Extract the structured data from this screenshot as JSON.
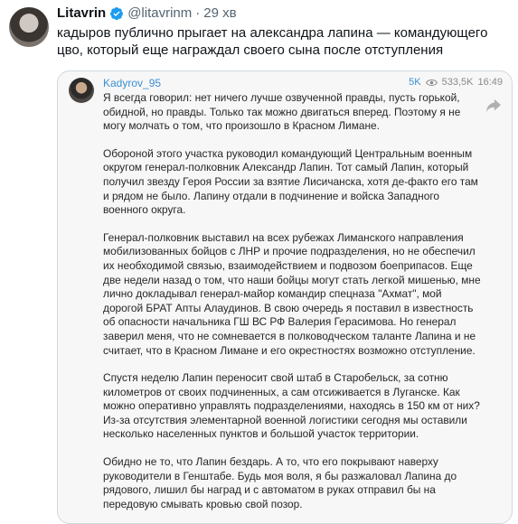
{
  "tweet": {
    "author_name": "Litavrin",
    "handle": "@litavrinm",
    "separator": "·",
    "time": "29 хв",
    "text": "кадыров публично прыгает на александра лапина — командующего цво, который еще награждал своего сына после отступления"
  },
  "embed": {
    "channel": "Kadyrov_95",
    "likes": "5K",
    "views": "533,5K",
    "time": "16:49",
    "paragraphs": [
      "Я всегда говорил: нет ничего лучше озвученной правды, пусть горькой, обидной, но правды. Только так можно двигаться вперед. Поэтому я не могу молчать о том, что произошло в Красном Лимане.",
      "Обороной этого участка руководил командующий Центральным военным округом генерал-полковник Александр Лапин. Тот самый Лапин, который получил звезду Героя России за взятие Лисичанска, хотя де-факто его там и рядом не было. Лапину отдали в подчинение и войска Западного военного округа.",
      "Генерал-полковник выставил на всех рубежах Лиманского направления мобилизованных бойцов с ЛНР и прочие подразделения, но не обеспечил их необходимой связью, взаимодействием и подвозом боеприпасов. Еще две недели назад о том, что наши бойцы могут стать легкой мишенью, мне лично докладывал генерал-майор командир спецназа \"Ахмат\", мой дорогой БРАТ Апты Алаудинов. В свою очередь я поставил в известность об опасности начальника ГШ ВС РФ Валерия Герасимова. Но генерал заверил меня, что не сомневается в полководческом таланте Лапина и не считает, что в Красном Лимане и его окрестностях возможно отступление.",
      "Спустя неделю Лапин переносит свой штаб в Старобельск, за сотню километров от своих подчиненных, а сам отсиживается в Луганске. Как можно оперативно управлять подразделениями, находясь в 150 км от них? Из-за отсутствия элементарной военной логистики сегодня мы оставили несколько населенных пунктов и большой участок территории.",
      "Обидно не то, что Лапин бездарь. А то, что его покрывают наверху руководители в Генштабе. Будь моя воля, я бы разжаловал Лапина до рядового, лишил бы наград и с автоматом в руках отправил бы на передовую смывать кровью свой позор."
    ]
  },
  "colors": {
    "verified": "#1d9bf0",
    "telegram_blue": "#3a8fd3",
    "muted": "#536471"
  },
  "icons": [
    "verified-icon",
    "eye-icon",
    "share-icon"
  ]
}
